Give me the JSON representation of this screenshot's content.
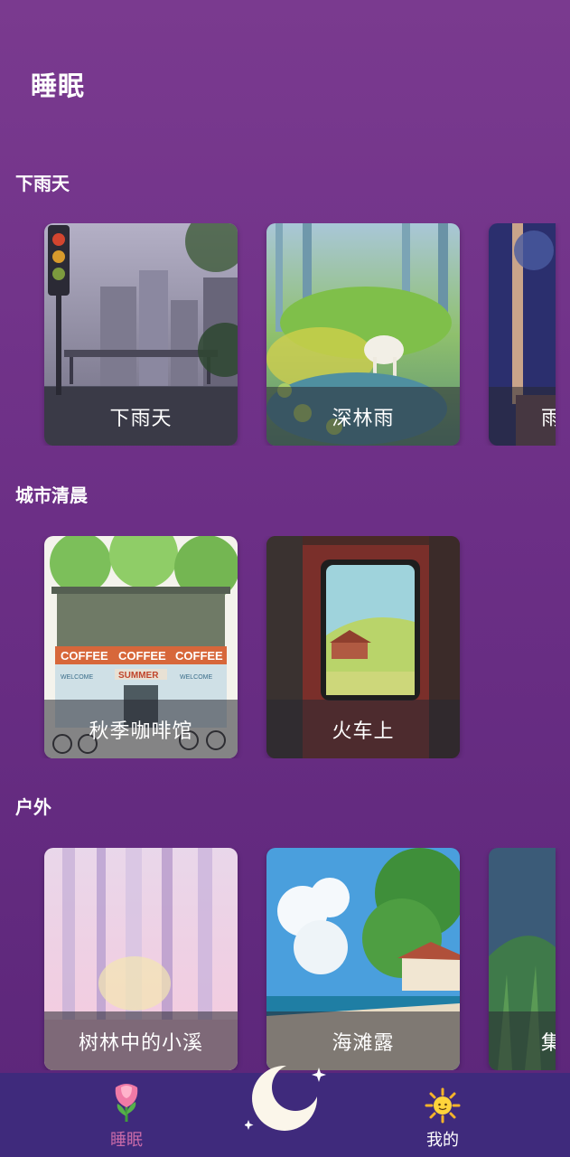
{
  "header": {
    "title": "睡眠"
  },
  "sections": [
    {
      "title": "下雨天",
      "cards": [
        "下雨天",
        "深林雨",
        "雨"
      ]
    },
    {
      "title": "城市清晨",
      "cards": [
        "秋季咖啡馆",
        "火车上"
      ]
    },
    {
      "title": "户外",
      "cards": [
        "树林中的小溪",
        "海滩露",
        "集"
      ]
    }
  ],
  "cafe_sign": {
    "coffee": "COFFEE",
    "summer": "SUMMER",
    "welcome": "WELCOME"
  },
  "nav": {
    "sleep_label": "睡眠",
    "mine_label": "我的",
    "active_color": "#c86aa8",
    "sleep_icon": "rose-icon",
    "center_icon": "moon-icon",
    "mine_icon": "sun-icon"
  }
}
